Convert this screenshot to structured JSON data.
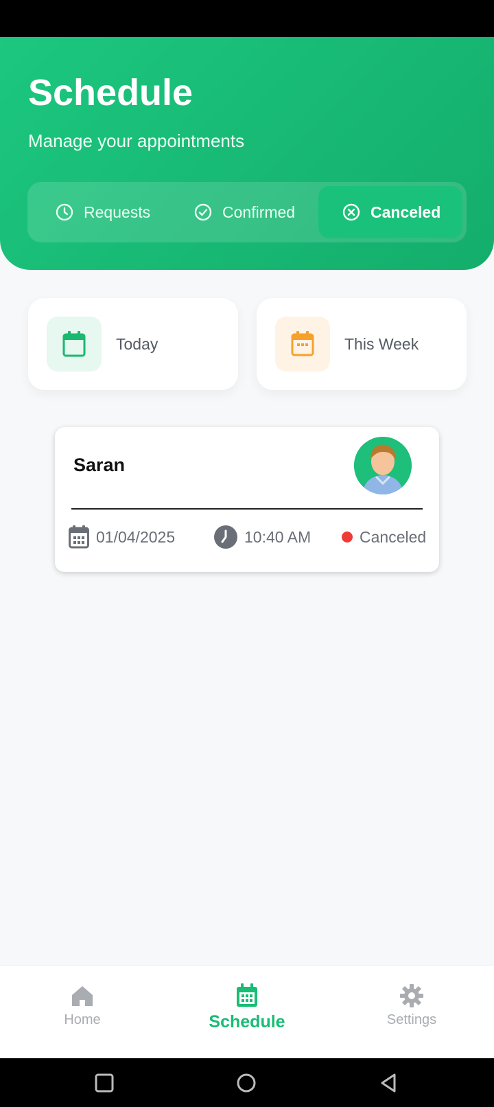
{
  "header": {
    "title": "Schedule",
    "subtitle": "Manage your appointments"
  },
  "tabs": [
    {
      "label": "Requests",
      "icon": "clock-icon",
      "active": false
    },
    {
      "label": "Confirmed",
      "icon": "check-circle-icon",
      "active": false
    },
    {
      "label": "Canceled",
      "icon": "x-circle-icon",
      "active": true
    }
  ],
  "stats": {
    "today": {
      "label": "Today",
      "icon": "calendar-icon",
      "color": "#1ab870"
    },
    "week": {
      "label": "This Week",
      "icon": "calendar-grid-icon",
      "color": "#f5a12b"
    }
  },
  "appointment": {
    "name": "Saran",
    "date": "01/04/2025",
    "time": "10:40 AM",
    "status": "Canceled",
    "status_color": "#ef3b36"
  },
  "bottom_nav": {
    "home": "Home",
    "schedule": "Schedule",
    "settings": "Settings",
    "active": "schedule",
    "active_color": "#17bd74"
  },
  "colors": {
    "brand_green": "#1cc77f",
    "background": "#f7f8fa"
  }
}
